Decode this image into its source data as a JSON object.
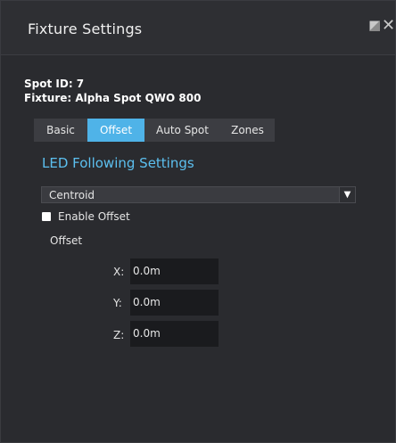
{
  "window": {
    "title": "Fixture Settings",
    "restore_icon": "restore-icon",
    "close_icon": "close-icon"
  },
  "info": {
    "spot_id": "Spot ID: 7",
    "fixture": "Fixture: Alpha Spot QWO 800"
  },
  "tabs": [
    {
      "label": "Basic",
      "active": false
    },
    {
      "label": "Offset",
      "active": true
    },
    {
      "label": "Auto Spot",
      "active": false
    },
    {
      "label": "Zones",
      "active": false
    }
  ],
  "led": {
    "section_title": "LED Following Settings",
    "mode_selected": "Centroid",
    "enable_offset_label": "Enable Offset",
    "enable_offset_checked": false,
    "offset_label": "Offset",
    "x_label": "X:",
    "x_value": "0.0m",
    "y_label": "Y:",
    "y_value": "0.0m",
    "z_label": "Z:",
    "z_value": "0.0m"
  },
  "colors": {
    "accent": "#4fb3e8",
    "section_title": "#5cc0f0",
    "background": "#2a2b2f"
  }
}
